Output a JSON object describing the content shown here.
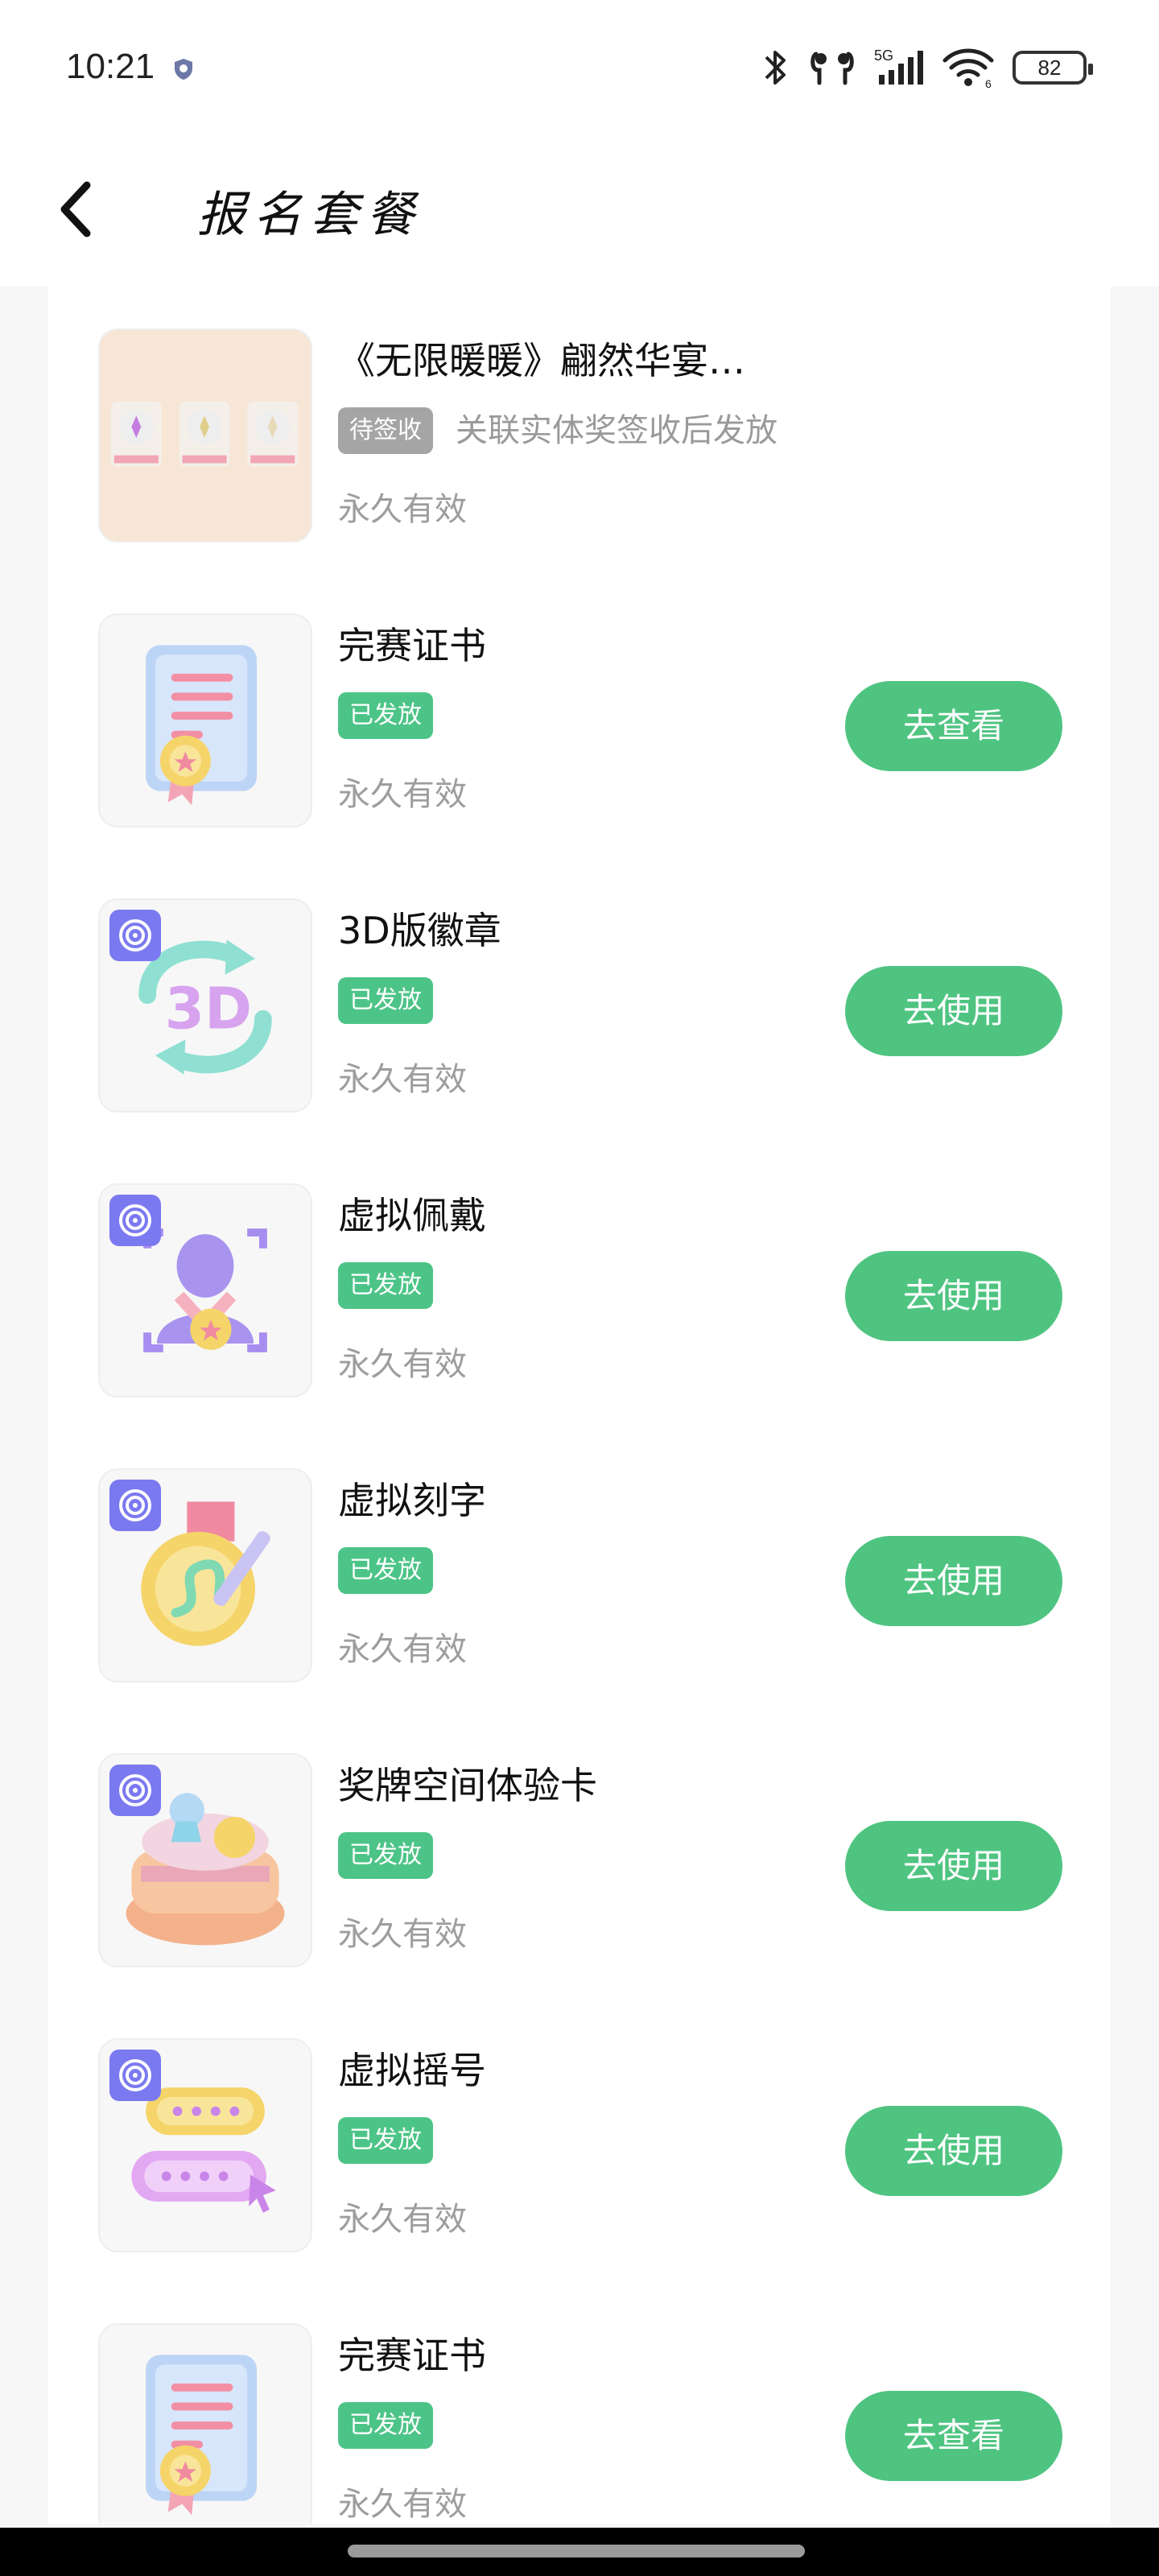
{
  "status_bar": {
    "time": "10:21",
    "signal_label": "5G",
    "wifi_sub": "6",
    "battery": "82",
    "icons": [
      "shield-icon",
      "bluetooth-icon",
      "earbuds-icon",
      "signal-icon",
      "wifi-icon",
      "battery-icon"
    ]
  },
  "nav": {
    "title": "报名套餐",
    "back_icon": "chevron-left-icon"
  },
  "colors": {
    "accent_green": "#4fc481",
    "badge_green": "#4dc487",
    "badge_gray": "#a5a5a5",
    "nfc_purple": "#7b79f0"
  },
  "items": [
    {
      "title": "《无限暖暖》翩然华宴…",
      "badge": "待签收",
      "badge_note": "关联实体奖签收后发放",
      "validity": "永久有效",
      "button": "",
      "icon": "gift-set-icon"
    },
    {
      "title": "完赛证书",
      "badge": "已发放",
      "validity": "永久有效",
      "button": "去查看",
      "icon": "certificate-icon"
    },
    {
      "title": "3D版徽章",
      "badge": "已发放",
      "validity": "永久有效",
      "button": "去使用",
      "icon": "3d-badge-icon"
    },
    {
      "title": "虚拟佩戴",
      "badge": "已发放",
      "validity": "永久有效",
      "button": "去使用",
      "icon": "virtual-wear-icon"
    },
    {
      "title": "虚拟刻字",
      "badge": "已发放",
      "validity": "永久有效",
      "button": "去使用",
      "icon": "engrave-medal-icon"
    },
    {
      "title": "奖牌空间体验卡",
      "badge": "已发放",
      "validity": "永久有效",
      "button": "去使用",
      "icon": "medal-space-icon"
    },
    {
      "title": "虚拟摇号",
      "badge": "已发放",
      "validity": "永久有效",
      "button": "去使用",
      "icon": "lottery-icon"
    },
    {
      "title": "完赛证书",
      "badge": "已发放",
      "validity": "永久有效",
      "button": "去查看",
      "icon": "certificate-icon"
    }
  ]
}
